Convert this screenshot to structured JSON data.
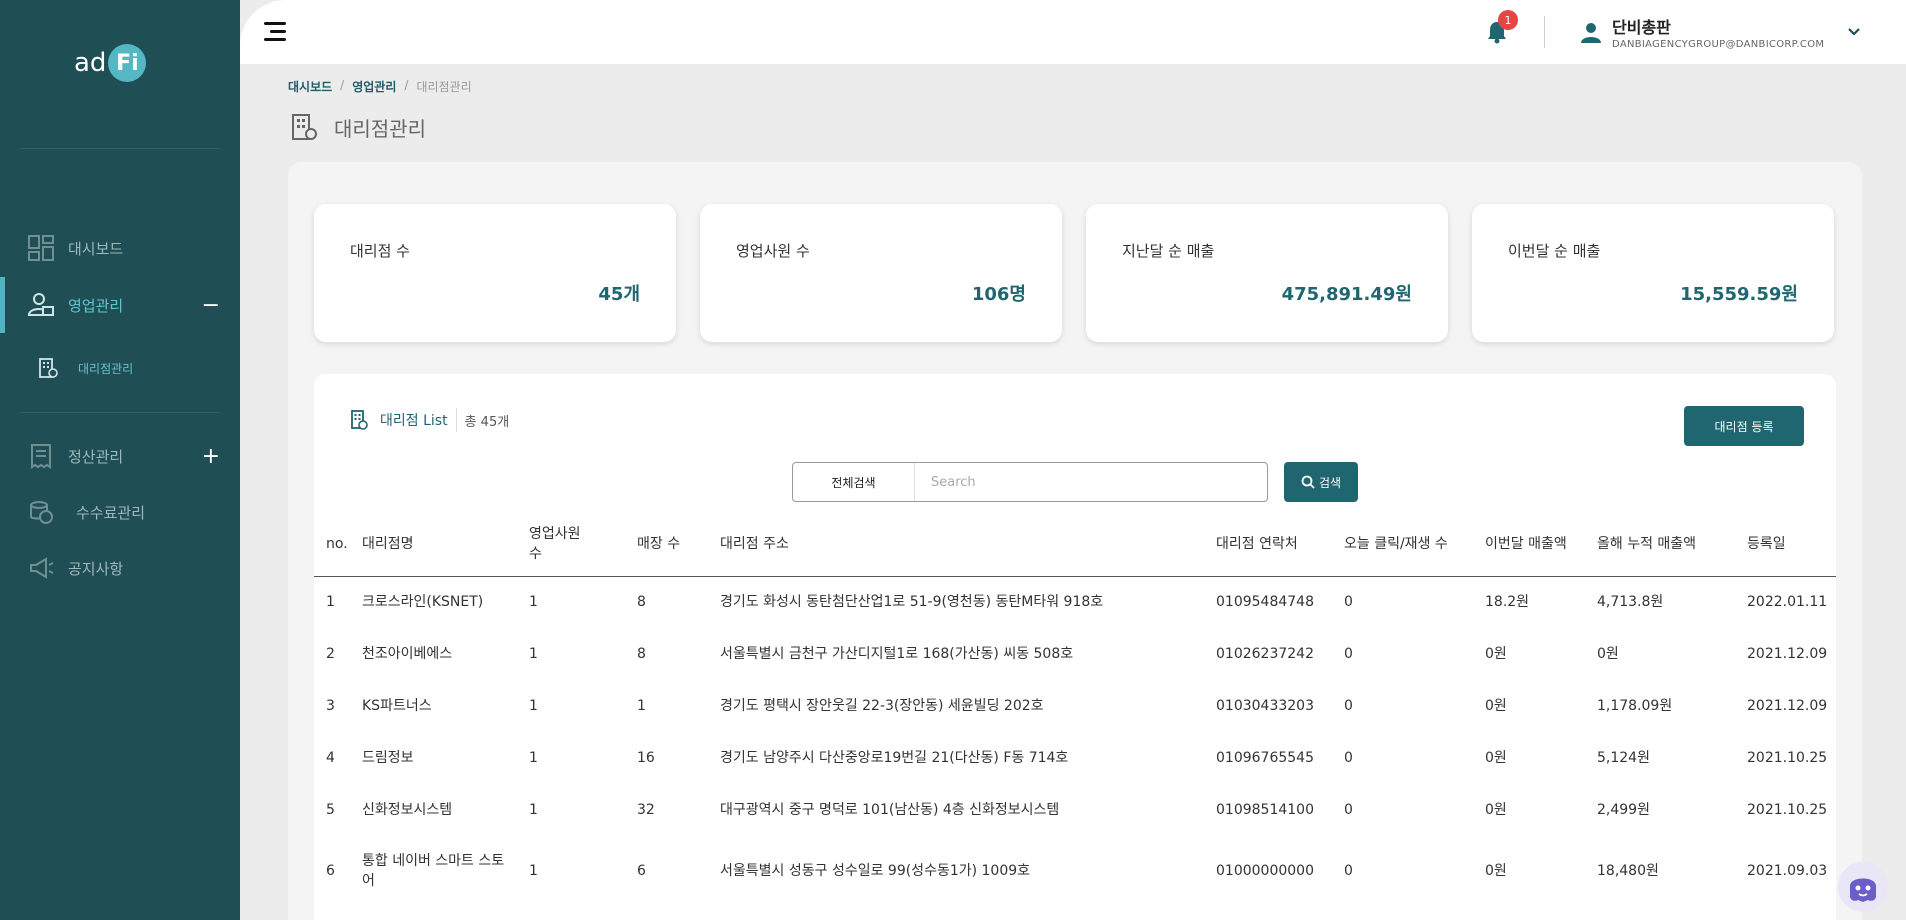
{
  "app": {
    "logo_text": "ad",
    "logo_badge": "Fi"
  },
  "sidebar": {
    "items": [
      {
        "label": "대시보드",
        "icon": "dashboard-icon"
      },
      {
        "label": "영업관리",
        "icon": "sales-user-icon",
        "toggle": "−"
      },
      {
        "label": "정산관리",
        "icon": "receipt-icon",
        "toggle": "+"
      },
      {
        "label": "수수료관리",
        "icon": "fee-coins-icon"
      },
      {
        "label": "공지사항",
        "icon": "megaphone-icon"
      }
    ],
    "sub_items": [
      {
        "label": "대리점관리",
        "icon": "agency-building-icon"
      }
    ]
  },
  "header": {
    "notification_count": "1",
    "user_name": "단비총판",
    "user_email": "DANBIAGENCYGROUP@DANBICORP.COM"
  },
  "breadcrumb": {
    "items": [
      "대시보드",
      "영업관리",
      "대리점관리"
    ],
    "separator": "/"
  },
  "page": {
    "title": "대리점관리"
  },
  "stats": [
    {
      "label": "대리점 수",
      "value": "45개"
    },
    {
      "label": "영업사원 수",
      "value": "106명"
    },
    {
      "label": "지난달 순 매출",
      "value": "475,891.49원"
    },
    {
      "label": "이번달 순 매출",
      "value": "15,559.59원"
    }
  ],
  "list": {
    "title": "대리점 List",
    "count": "총 45개",
    "register_label": "대리점 등록",
    "search_scope": "전체검색",
    "search_placeholder": "Search",
    "search_button": "검색",
    "columns": [
      "no.",
      "대리점명",
      "영업사원 수",
      "매장 수",
      "대리점 주소",
      "대리점 연락처",
      "오늘 클릭/재생 수",
      "이번달 매출액",
      "올해 누적 매출액",
      "등록일"
    ],
    "rows": [
      [
        "1",
        "크로스라인(KSNET)",
        "1",
        "8",
        "경기도 화성시 동탄첨단산업1로 51-9(영천동) 동탄M타워 918호",
        "01095484748",
        "0",
        "18.2원",
        "4,713.8원",
        "2022.01.11"
      ],
      [
        "2",
        "천조아이베에스",
        "1",
        "8",
        "서울특별시 금천구 가산디지털1로 168(가산동) 씨동 508호",
        "01026237242",
        "0",
        "0원",
        "0원",
        "2021.12.09"
      ],
      [
        "3",
        "KS파트너스",
        "1",
        "1",
        "경기도 평택시 장안웃길 22-3(장안동) 세윤빌딩 202호",
        "01030433203",
        "0",
        "0원",
        "1,178.09원",
        "2021.12.09"
      ],
      [
        "4",
        "드림정보",
        "1",
        "16",
        "경기도 남양주시 다산중앙로19번길 21(다산동) F동 714호",
        "01096765545",
        "0",
        "0원",
        "5,124원",
        "2021.10.25"
      ],
      [
        "5",
        "신화정보시스템",
        "1",
        "32",
        "대구광역시 중구 명덕로 101(남산동) 4층 신화정보시스템",
        "01098514100",
        "0",
        "0원",
        "2,499원",
        "2021.10.25"
      ],
      [
        "6",
        "통합 네이버 스마트 스토어",
        "1",
        "6",
        "서울특별시 성동구 성수일로 99(성수동1가) 1009호",
        "01000000000",
        "0",
        "0원",
        "18,480원",
        "2021.09.03"
      ]
    ]
  },
  "colors": {
    "sidebar_bg": "#1f4f55",
    "accent": "#1f6670",
    "active_text": "#63c4d2",
    "badge": "#e64545"
  }
}
